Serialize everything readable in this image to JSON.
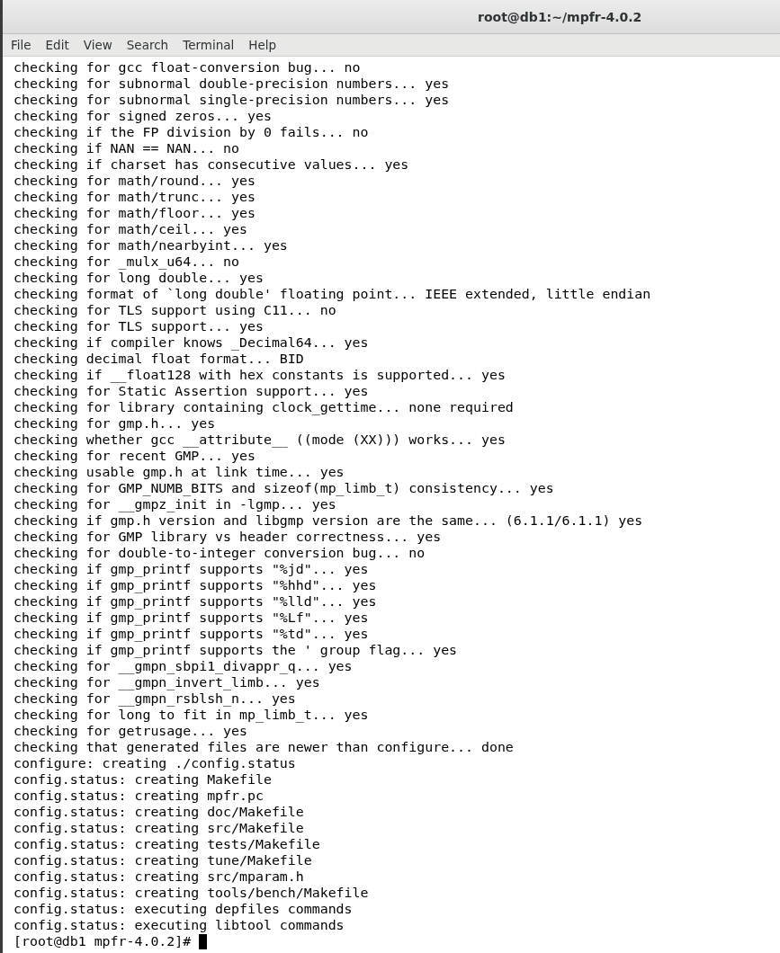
{
  "window": {
    "title": "root@db1:~/mpfr-4.0.2"
  },
  "menu": [
    "File",
    "Edit",
    "View",
    "Search",
    "Terminal",
    "Help"
  ],
  "lines": [
    "checking for gcc float-conversion bug... no",
    "checking for subnormal double-precision numbers... yes",
    "checking for subnormal single-precision numbers... yes",
    "checking for signed zeros... yes",
    "checking if the FP division by 0 fails... no",
    "checking if NAN == NAN... no",
    "checking if charset has consecutive values... yes",
    "checking for math/round... yes",
    "checking for math/trunc... yes",
    "checking for math/floor... yes",
    "checking for math/ceil... yes",
    "checking for math/nearbyint... yes",
    "checking for _mulx_u64... no",
    "checking for long double... yes",
    "checking format of `long double' floating point... IEEE extended, little endian",
    "checking for TLS support using C11... no",
    "checking for TLS support... yes",
    "checking if compiler knows _Decimal64... yes",
    "checking decimal float format... BID",
    "checking if __float128 with hex constants is supported... yes",
    "checking for Static Assertion support... yes",
    "checking for library containing clock_gettime... none required",
    "checking for gmp.h... yes",
    "checking whether gcc __attribute__ ((mode (XX))) works... yes",
    "checking for recent GMP... yes",
    "checking usable gmp.h at link time... yes",
    "checking for GMP_NUMB_BITS and sizeof(mp_limb_t) consistency... yes",
    "checking for __gmpz_init in -lgmp... yes",
    "checking if gmp.h version and libgmp version are the same... (6.1.1/6.1.1) yes",
    "checking for GMP library vs header correctness... yes",
    "checking for double-to-integer conversion bug... no",
    "checking if gmp_printf supports \"%jd\"... yes",
    "checking if gmp_printf supports \"%hhd\"... yes",
    "checking if gmp_printf supports \"%lld\"... yes",
    "checking if gmp_printf supports \"%Lf\"... yes",
    "checking if gmp_printf supports \"%td\"... yes",
    "checking if gmp_printf supports the ' group flag... yes",
    "checking for __gmpn_sbpi1_divappr_q... yes",
    "checking for __gmpn_invert_limb... yes",
    "checking for __gmpn_rsblsh_n... yes",
    "checking for long to fit in mp_limb_t... yes",
    "checking for getrusage... yes",
    "checking that generated files are newer than configure... done",
    "configure: creating ./config.status",
    "config.status: creating Makefile",
    "config.status: creating mpfr.pc",
    "config.status: creating doc/Makefile",
    "config.status: creating src/Makefile",
    "config.status: creating tests/Makefile",
    "config.status: creating tune/Makefile",
    "config.status: creating src/mparam.h",
    "config.status: creating tools/bench/Makefile",
    "config.status: executing depfiles commands",
    "config.status: executing libtool commands"
  ],
  "prompt": "[root@db1 mpfr-4.0.2]#"
}
